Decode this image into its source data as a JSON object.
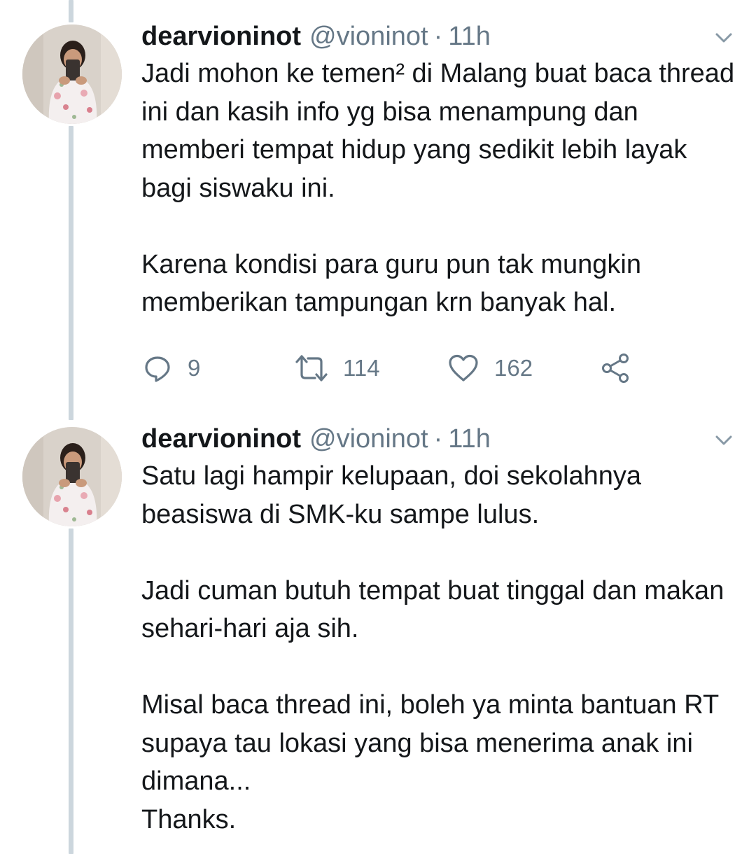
{
  "tweets": [
    {
      "display_name": "dearvioninot",
      "handle": "@vioninot",
      "separator": "·",
      "time": "11h",
      "paragraphs": [
        "Jadi mohon ke temen² di Malang buat baca thread ini dan kasih info yg bisa menampung dan memberi tempat hidup yang sedikit lebih layak bagi siswaku ini.",
        "Karena kondisi para guru pun tak mungkin memberikan tampungan krn banyak hal."
      ],
      "replies": "9",
      "retweets": "114",
      "likes": "162"
    },
    {
      "display_name": "dearvioninot",
      "handle": "@vioninot",
      "separator": "·",
      "time": "11h",
      "paragraphs": [
        "Satu lagi hampir kelupaan, doi sekolahnya beasiswa di SMK-ku sampe lulus.",
        "Jadi cuman butuh tempat buat tinggal dan makan sehari-hari aja sih.",
        "Misal baca thread ini, boleh ya minta bantuan RT supaya tau lokasi yang bisa menerima anak ini dimana...\nThanks."
      ]
    }
  ],
  "icons": {
    "reply": "reply-bubble-icon",
    "retweet": "retweet-arrows-icon",
    "like": "heart-icon",
    "share": "share-nodes-icon",
    "caret": "chevron-down-icon"
  },
  "colors": {
    "text": "#14171a",
    "muted": "#657786",
    "thread_line": "#ccd6dd"
  }
}
